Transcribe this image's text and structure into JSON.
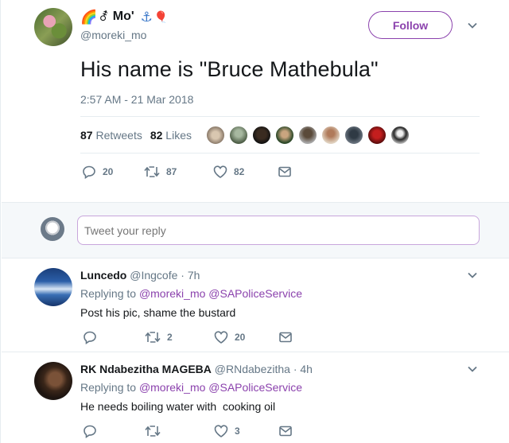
{
  "main_tweet": {
    "display_name": "Mo'",
    "name_emojis": [
      "🌈",
      "⚦",
      "⚓",
      "🎈"
    ],
    "handle": "@moreki_mo",
    "follow_label": "Follow",
    "text": "His name is \"Bruce Mathebula\"",
    "timestamp": "2:57 AM - 21 Mar 2018",
    "retweets_count": "87",
    "retweets_label": "Retweets",
    "likes_count": "82",
    "likes_label": "Likes",
    "actions": {
      "replies": "20",
      "retweets": "87",
      "likes": "82"
    }
  },
  "reply_box": {
    "placeholder": "Tweet your reply"
  },
  "replies": [
    {
      "name": "Luncedo",
      "handle": "@Ingcofe",
      "time": "· 7h",
      "replying_prefix": "Replying to",
      "replying_to": [
        "@moreki_mo",
        "@SAPoliceService"
      ],
      "text": "Post his pic, shame the bustard",
      "counts": {
        "replies": "",
        "retweets": "2",
        "likes": "20"
      }
    },
    {
      "name": "RK Ndabezitha MAGEBA",
      "handle": "@RNdabezitha",
      "time": "· 4h",
      "replying_prefix": "Replying to",
      "replying_to": [
        "@moreki_mo",
        "@SAPoliceService"
      ],
      "text": "He needs boiling water with  cooking oil",
      "counts": {
        "replies": "",
        "retweets": "",
        "likes": "3"
      }
    }
  ],
  "colors": {
    "accent": "#8b42ad",
    "muted": "#657786",
    "divider": "#e6ecf0",
    "text": "#14171a"
  }
}
